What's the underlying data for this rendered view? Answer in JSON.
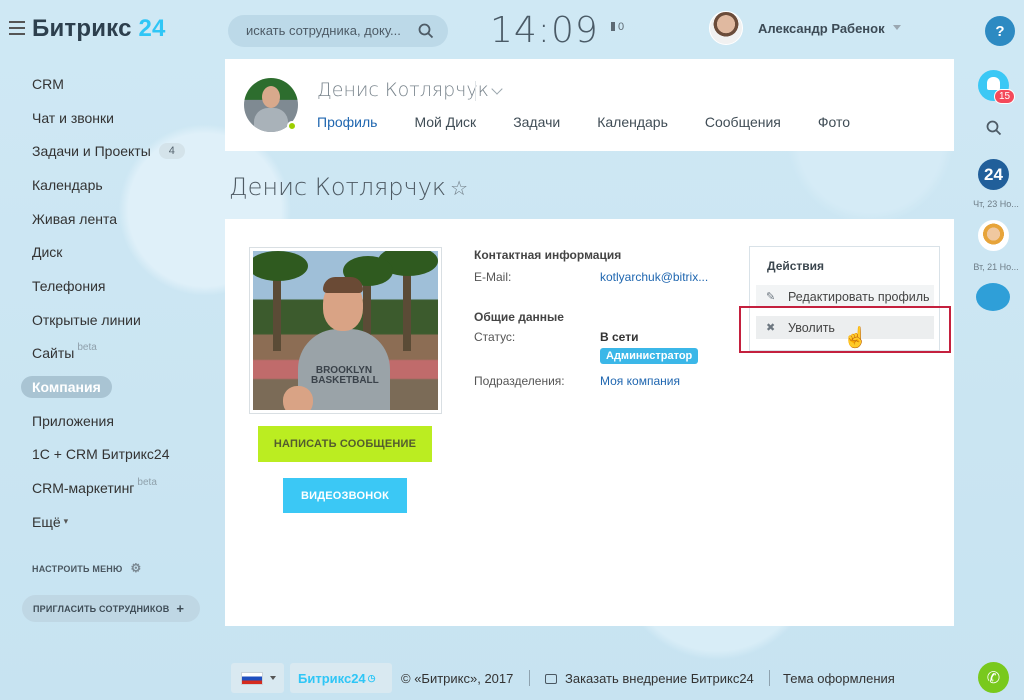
{
  "header": {
    "logo_text": "Битрикс",
    "logo_num": "24",
    "search_placeholder": "искать сотрудника, доку...",
    "clock": "14:09",
    "flag_count": "0",
    "user_name": "Александр Рабенок"
  },
  "sidebar": {
    "items": [
      {
        "label": "CRM"
      },
      {
        "label": "Чат и звонки"
      },
      {
        "label": "Задачи и Проекты",
        "badge": "4"
      },
      {
        "label": "Календарь"
      },
      {
        "label": "Живая лента"
      },
      {
        "label": "Диск"
      },
      {
        "label": "Телефония"
      },
      {
        "label": "Открытые линии"
      },
      {
        "label": "Сайты",
        "sup": "beta"
      },
      {
        "label": "Компания",
        "active": true
      },
      {
        "label": "Приложения"
      },
      {
        "label": "1С + CRM Битрикс24"
      },
      {
        "label": "CRM-маркетинг",
        "sup": "beta"
      },
      {
        "label": "Ещё"
      }
    ],
    "setup_menu": "НАСТРОИТЬ МЕНЮ",
    "invite": "ПРИГЛАСИТЬ СОТРУДНИКОВ"
  },
  "profile_header": {
    "name": "Денис Котлярчук",
    "tabs": [
      "Профиль",
      "Мой Диск",
      "Задачи",
      "Календарь",
      "Сообщения",
      "Фото"
    ]
  },
  "page_title": "Денис Котлярчук",
  "profile": {
    "shirt_text": "BROOKLYN\nBASKETBALL",
    "write_message": "НАПИСАТЬ СООБЩЕНИЕ",
    "video_call": "ВИДЕОЗВОНОК",
    "contact_title": "Контактная информация",
    "email_label": "E-Mail:",
    "email_value": "kotlyarchuk@bitrix...",
    "general_title": "Общие данные",
    "status_label": "Статус:",
    "status_value": "В сети",
    "role_badge": "Администратор",
    "dept_label": "Подразделения:",
    "dept_value": "Моя компания"
  },
  "actions": {
    "title": "Действия",
    "edit": "Редактировать профиль",
    "fire": "Уволить"
  },
  "rail": {
    "help": "?",
    "notif_count": "15",
    "b24": "24",
    "date1": "Чт, 23 Но...",
    "date2": "Вт, 21 Но..."
  },
  "footer": {
    "badge_name": "Битрикс24",
    "copyright": "© «Битрикс», 2017",
    "order": "Заказать внедрение Битрикс24",
    "theme": "Тема оформления"
  },
  "colors": {
    "accent": "#2fc6f6",
    "link": "#2067b0",
    "msg_button": "#bbed21",
    "video_button": "#3bc8f5",
    "highlight_border": "#c4203e"
  }
}
